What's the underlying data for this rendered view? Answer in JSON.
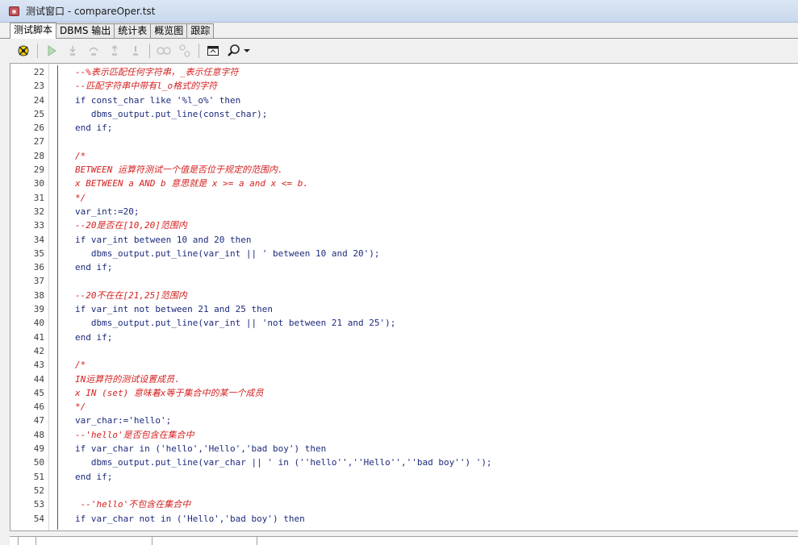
{
  "window": {
    "title": "测试窗口 - compareOper.tst",
    "icon": "test-window-icon"
  },
  "tabs": [
    {
      "label": "测试脚本",
      "active": true
    },
    {
      "label": "DBMS 输出",
      "active": false
    },
    {
      "label": "统计表",
      "active": false
    },
    {
      "label": "概览图",
      "active": false
    },
    {
      "label": "跟踪",
      "active": false
    }
  ],
  "toolbar": {
    "buttons": [
      "debug-icon",
      "run-icon",
      "step-into-icon",
      "step-over-icon",
      "step-out-icon",
      "run-to-exception-icon",
      "toggle-breakpoints-icon",
      "watch-icon",
      "window-icon",
      "find-icon",
      "dropdown-arrow-icon"
    ]
  },
  "colors": {
    "comment": "#d42020",
    "code": "#1c2a7c",
    "fold_guide": "#3c5c9c"
  },
  "editor": {
    "lines": [
      {
        "num": "22",
        "text": "--%表示匹配任何字符串，_表示任意字符",
        "type": "comment"
      },
      {
        "num": "23",
        "text": "--匹配字符串中带有l_o格式的字符",
        "type": "comment"
      },
      {
        "num": "24",
        "text": "if const_char like '%l_o%' then",
        "type": "code"
      },
      {
        "num": "25",
        "text": "   dbms_output.put_line(const_char);",
        "type": "code"
      },
      {
        "num": "26",
        "text": "end if;",
        "type": "code"
      },
      {
        "num": "27",
        "text": "",
        "type": "code"
      },
      {
        "num": "28",
        "text": "/*",
        "type": "comment"
      },
      {
        "num": "29",
        "text": "BETWEEN 运算符测试一个值是否位于规定的范围内.",
        "type": "comment"
      },
      {
        "num": "30",
        "text": "x BETWEEN a AND b 意思就是 x >= a and x <= b.",
        "type": "comment"
      },
      {
        "num": "31",
        "text": "*/",
        "type": "comment"
      },
      {
        "num": "32",
        "text": "var_int:=20;",
        "type": "code"
      },
      {
        "num": "33",
        "text": "--20是否在[10,20]范围内",
        "type": "comment"
      },
      {
        "num": "34",
        "text": "if var_int between 10 and 20 then",
        "type": "code"
      },
      {
        "num": "35",
        "text": "   dbms_output.put_line(var_int || ' between 10 and 20');",
        "type": "code"
      },
      {
        "num": "36",
        "text": "end if;",
        "type": "code"
      },
      {
        "num": "37",
        "text": "",
        "type": "code"
      },
      {
        "num": "38",
        "text": "--20不在在[21,25]范围内",
        "type": "comment"
      },
      {
        "num": "39",
        "text": "if var_int not between 21 and 25 then",
        "type": "code"
      },
      {
        "num": "40",
        "text": "   dbms_output.put_line(var_int || 'not between 21 and 25');",
        "type": "code"
      },
      {
        "num": "41",
        "text": "end if;",
        "type": "code"
      },
      {
        "num": "42",
        "text": "",
        "type": "code"
      },
      {
        "num": "43",
        "text": "/*",
        "type": "comment"
      },
      {
        "num": "44",
        "text": "IN运算符的测试设置成员.",
        "type": "comment"
      },
      {
        "num": "45",
        "text": "x IN (set) 意味着x等于集合中的某一个成员",
        "type": "comment"
      },
      {
        "num": "46",
        "text": "*/",
        "type": "comment"
      },
      {
        "num": "47",
        "text": "var_char:='hello';",
        "type": "code"
      },
      {
        "num": "48",
        "text": "--'hello'是否包含在集合中",
        "type": "comment"
      },
      {
        "num": "49",
        "text": "if var_char in ('hello','Hello','bad boy') then",
        "type": "code"
      },
      {
        "num": "50",
        "text": "   dbms_output.put_line(var_char || ' in (''hello'',''Hello'',''bad boy'') ');",
        "type": "code"
      },
      {
        "num": "51",
        "text": "end if;",
        "type": "code"
      },
      {
        "num": "52",
        "text": "",
        "type": "code"
      },
      {
        "num": "53",
        "text": " --'hello'不包含在集合中",
        "type": "comment"
      },
      {
        "num": "54",
        "text": "if var_char not in ('Hello','bad boy') then",
        "type": "code"
      }
    ]
  }
}
